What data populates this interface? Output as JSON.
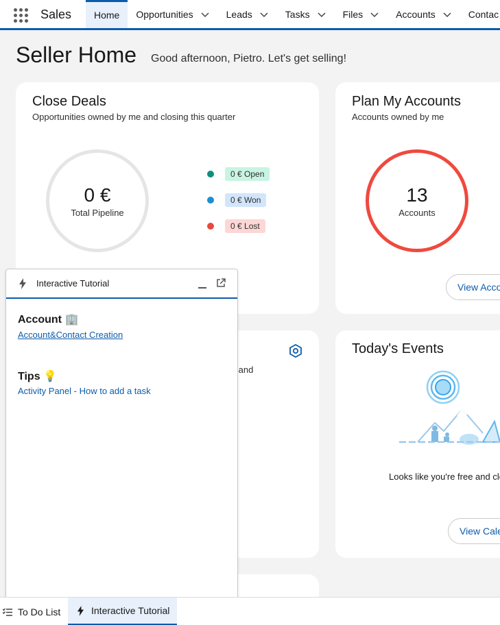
{
  "app": {
    "name": "Sales"
  },
  "nav": {
    "tabs": [
      {
        "label": "Home",
        "has_menu": false,
        "active": true
      },
      {
        "label": "Opportunities",
        "has_menu": true
      },
      {
        "label": "Leads",
        "has_menu": true
      },
      {
        "label": "Tasks",
        "has_menu": true
      },
      {
        "label": "Files",
        "has_menu": true
      },
      {
        "label": "Accounts",
        "has_menu": true
      },
      {
        "label": "Contac",
        "has_menu": false
      }
    ]
  },
  "page": {
    "title": "Seller Home",
    "greeting": "Good afternoon, Pietro. Let's get selling!"
  },
  "close_deals": {
    "title": "Close Deals",
    "subtitle": "Opportunities owned by me and closing this quarter",
    "total_value": "0 €",
    "total_label": "Total Pipeline",
    "legend": [
      {
        "label": "0 € Open",
        "dot_color": "#04844b",
        "badge_bg": "#d4f5e6",
        "dot": "#0f8f7f"
      },
      {
        "label": "0 € Won",
        "dot_color": "#1b96ff",
        "badge_bg": "#d8e6fe",
        "dot": "#1b8fd0"
      },
      {
        "label": "0 € Lost",
        "dot_color": "#ea001e",
        "badge_bg": "#fddde0",
        "dot": "#e84a3e"
      }
    ]
  },
  "plan_accounts": {
    "title": "Plan My Accounts",
    "subtitle": "Accounts owned by me",
    "count": "13",
    "count_label": "Accounts",
    "view_button": "View Acco",
    "ring_color": "#f0493e"
  },
  "middle_card": {
    "partial_text": "ls, and"
  },
  "todays_events": {
    "title": "Today's Events",
    "empty_text": "Looks like you're free and cle",
    "view_button": "View Caler"
  },
  "tutorial": {
    "header_title": "Interactive Tutorial",
    "sections": [
      {
        "title": "Account",
        "emoji": "🏢",
        "link": "Account&Contact Creation",
        "underline": true
      },
      {
        "title": "Tips",
        "emoji": "💡",
        "link": "Activity Panel - How to add a task",
        "underline": false
      }
    ]
  },
  "utility_bar": {
    "items": [
      {
        "label": "To Do List",
        "icon": "checklist-icon"
      },
      {
        "label": "Interactive Tutorial",
        "icon": "lightning-icon",
        "active": true
      }
    ]
  },
  "colors": {
    "brand": "#0b5cab",
    "link": "#0b5cab"
  }
}
